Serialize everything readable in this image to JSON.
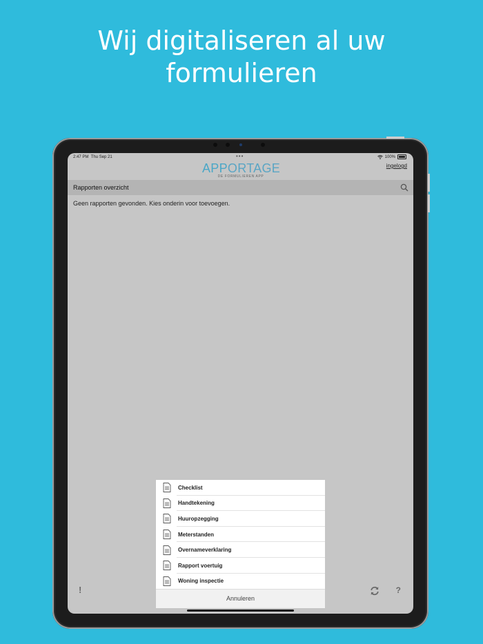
{
  "headline": {
    "line1": "Wij digitaliseren al uw",
    "line2": "formulieren"
  },
  "status_bar": {
    "time": "2:47 PM",
    "date": "Thu Sep 21",
    "dots": "•••",
    "battery": "100%"
  },
  "app": {
    "logo_app": "APP",
    "logo_ortage": "ORTAGE",
    "logo_sub": "DE FORMULIEREN APP",
    "login_link": "ingelogd",
    "overview_title": "Rapporten overzicht",
    "empty_message": "Geen rapporten gevonden. Kies onderin voor toevoegen."
  },
  "action_sheet": {
    "items": [
      {
        "label": "Checklist"
      },
      {
        "label": "Handtekening"
      },
      {
        "label": "Huuropzegging"
      },
      {
        "label": "Meterstanden"
      },
      {
        "label": "Overnameverklaring"
      },
      {
        "label": "Rapport voertuig"
      },
      {
        "label": "Woning inspectie"
      }
    ],
    "cancel": "Annuleren"
  },
  "bottom_bar": {
    "exclamation": "!",
    "help": "?"
  },
  "icons": {
    "search": "search-icon",
    "document": "document-icon",
    "refresh": "refresh-icon",
    "wifi": "wifi-icon",
    "battery": "battery-icon"
  }
}
